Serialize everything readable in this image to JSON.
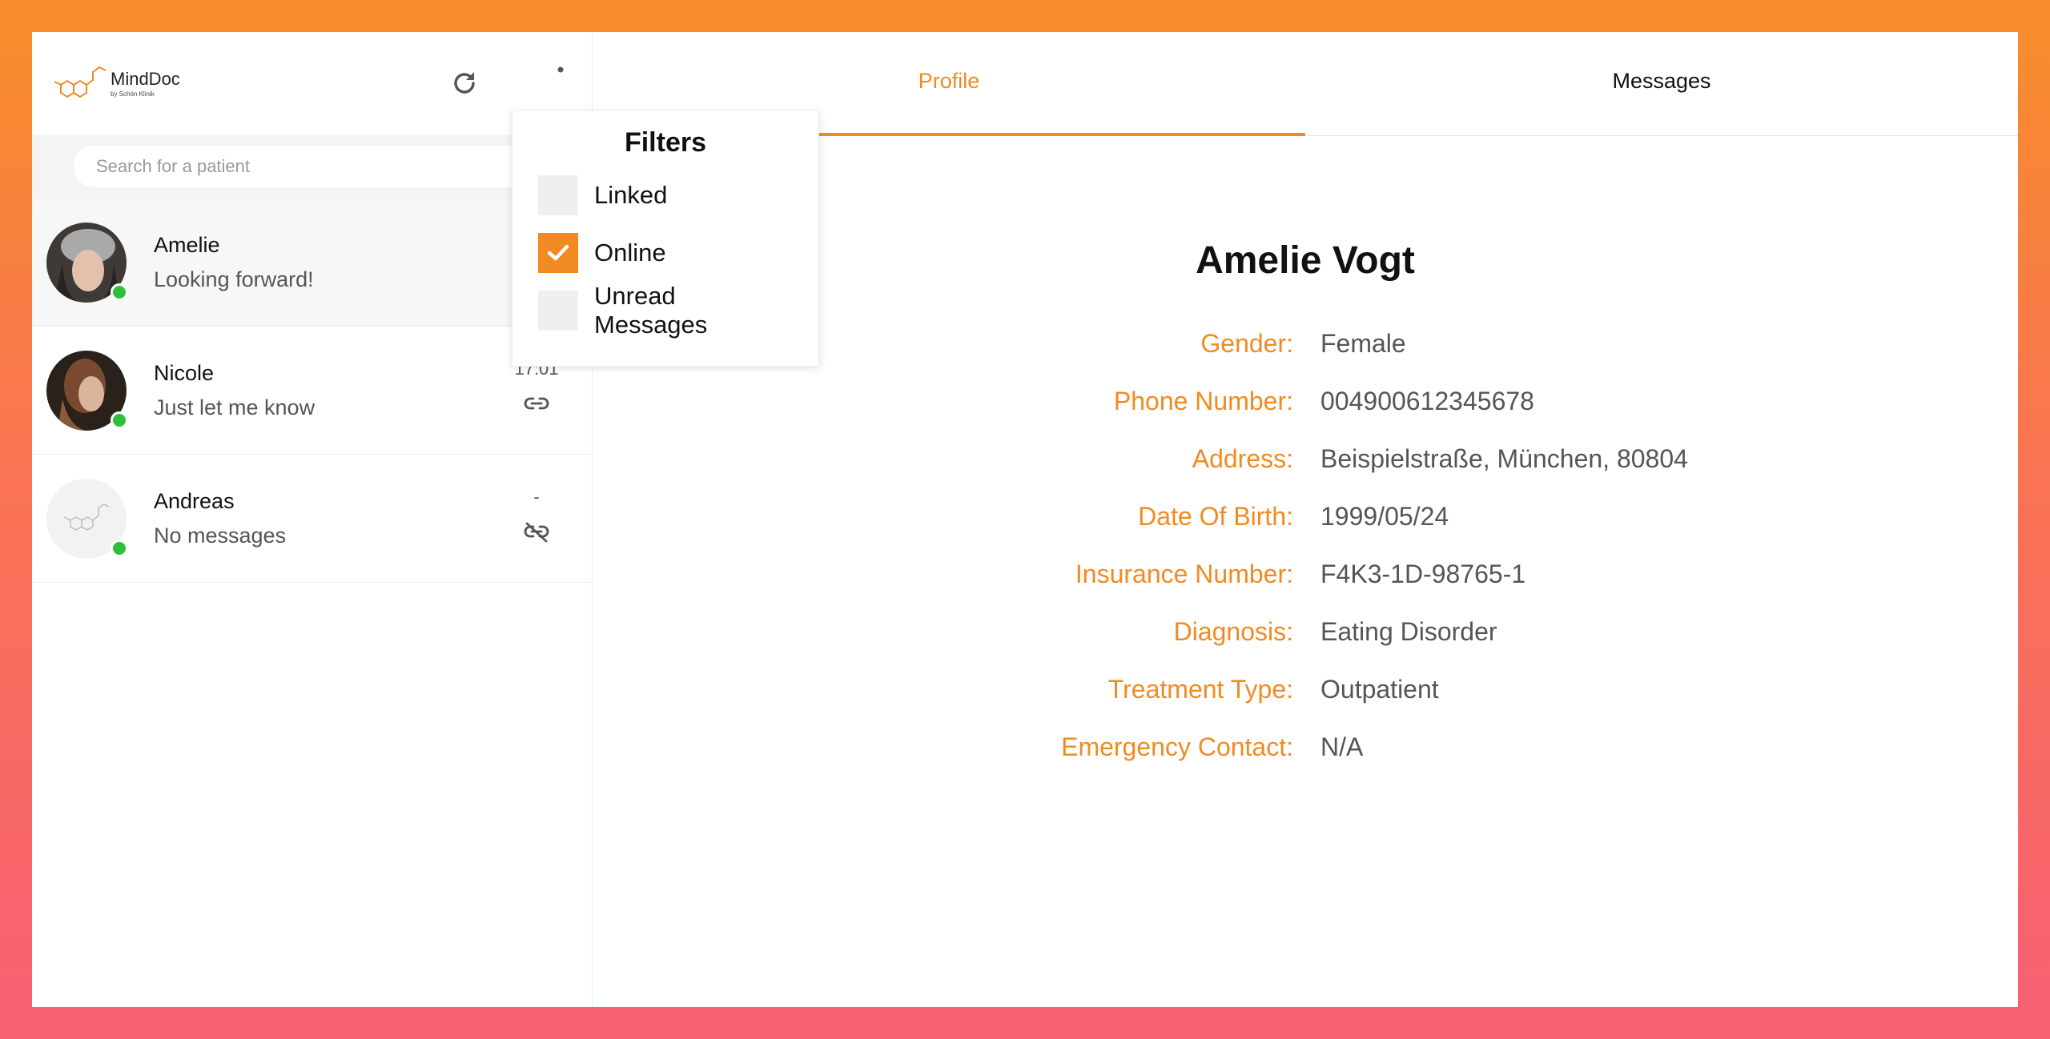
{
  "brand": {
    "name": "MindDoc",
    "sub": "by Schön Klinik",
    "accent": "#f28a22"
  },
  "search": {
    "placeholder": "Search for a patient"
  },
  "patients": [
    {
      "name": "Amelie",
      "last_message": "Looking forward!",
      "time": "",
      "online": true,
      "linked": true,
      "selected": true
    },
    {
      "name": "Nicole",
      "last_message": "Just let me know",
      "time": "17:01",
      "online": true,
      "linked": true,
      "selected": false
    },
    {
      "name": "Andreas",
      "last_message": "No messages",
      "time": "-",
      "online": true,
      "linked": false,
      "selected": false
    }
  ],
  "filters": {
    "title": "Filters",
    "options": [
      {
        "label": "Linked",
        "checked": false
      },
      {
        "label": "Online",
        "checked": true
      },
      {
        "label": "Unread Messages",
        "checked": false
      }
    ]
  },
  "tabs": [
    {
      "label": "Profile",
      "active": true
    },
    {
      "label": "Messages",
      "active": false
    }
  ],
  "profile": {
    "name": "Amelie Vogt",
    "fields": [
      {
        "label": "Gender:",
        "value": "Female"
      },
      {
        "label": "Phone Number:",
        "value": "004900612345678"
      },
      {
        "label": "Address:",
        "value": "Beispielstraße, München, 80804"
      },
      {
        "label": "Date Of Birth:",
        "value": "1999/05/24"
      },
      {
        "label": "Insurance Number:",
        "value": "F4K3-1D-98765-1"
      },
      {
        "label": "Diagnosis:",
        "value": "Eating Disorder"
      },
      {
        "label": "Treatment Type:",
        "value": "Outpatient"
      },
      {
        "label": "Emergency Contact:",
        "value": "N/A"
      }
    ]
  }
}
